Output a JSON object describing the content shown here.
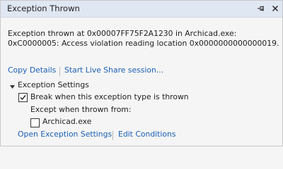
{
  "window": {
    "title": "Exception Thrown"
  },
  "message": {
    "line1": "Exception thrown at 0x00007FF75F2A1230 in Archicad.exe:",
    "line2": "0xC0000005: Access violation reading location 0x0000000000000019."
  },
  "actions": {
    "copy_details": "Copy Details",
    "live_share": "Start Live Share session..."
  },
  "settings": {
    "heading": "Exception Settings",
    "break_label": "Break when this exception type is thrown",
    "break_checked": true,
    "except_label": "Except when thrown from:",
    "module_label": "Archicad.exe",
    "module_checked": false
  },
  "footer": {
    "open_settings": "Open Exception Settings",
    "edit_conditions": "Edit Conditions"
  },
  "colors": {
    "link": "#1a5fb4",
    "titlebar": "#dfe7f3"
  }
}
